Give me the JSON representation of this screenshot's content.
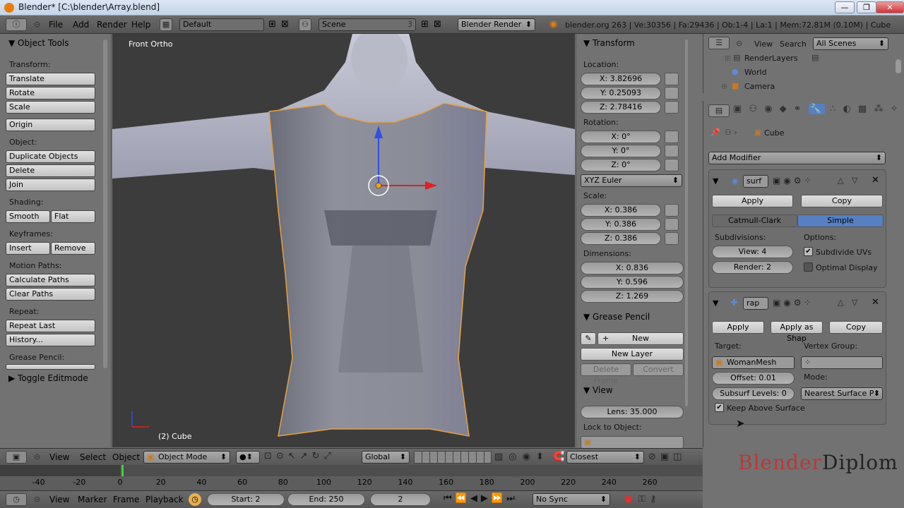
{
  "window": {
    "title": "Blender* [C:\\blender\\Array.blend]",
    "min": "—",
    "max": "❐",
    "close": "✕"
  },
  "info": {
    "menus": [
      "File",
      "Add",
      "Render",
      "Help"
    ],
    "screen": "Default",
    "scene": "Scene",
    "scene_count": "3",
    "engine": "Blender Render",
    "stats": "blender.org 263 | Ve:30356 | Fa:29436 | Ob:1-4 | La:1 | Mem:72.81M (0.10M) | Cube"
  },
  "tools": {
    "header": "Object Tools",
    "transform_label": "Transform:",
    "translate": "Translate",
    "rotate": "Rotate",
    "scale": "Scale",
    "origin": "Origin",
    "object_label": "Object:",
    "duplicate": "Duplicate Objects",
    "delete": "Delete",
    "join": "Join",
    "shading_label": "Shading:",
    "smooth": "Smooth",
    "flat": "Flat",
    "keyframes_label": "Keyframes:",
    "insert": "Insert",
    "remove": "Remove",
    "motion_label": "Motion Paths:",
    "calc_paths": "Calculate Paths",
    "clear_paths": "Clear Paths",
    "repeat_label": "Repeat:",
    "repeat_last": "Repeat Last",
    "history": "History...",
    "grease_label": "Grease Pencil:",
    "toggle_edit": "Toggle Editmode"
  },
  "viewport": {
    "view_name": "Front Ortho",
    "object_label": "(2) Cube"
  },
  "npanel": {
    "transform": "Transform",
    "location_label": "Location:",
    "loc_x": "X: 3.82696",
    "loc_y": "Y: 0.25093",
    "loc_z": "Z: 2.78416",
    "rotation_label": "Rotation:",
    "rot_x": "X: 0°",
    "rot_y": "Y: 0°",
    "rot_z": "Z: 0°",
    "rot_mode": "XYZ Euler",
    "scale_label": "Scale:",
    "sc_x": "X: 0.386",
    "sc_y": "Y: 0.386",
    "sc_z": "Z: 0.386",
    "dim_label": "Dimensions:",
    "dim_x": "X: 0.836",
    "dim_y": "Y: 0.596",
    "dim_z": "Z: 1.269",
    "grease": "Grease Pencil",
    "gp_new": "New",
    "gp_new_layer": "New Layer",
    "gp_delete_frame": "Delete Frame",
    "gp_convert": "Convert",
    "view": "View",
    "lens": "Lens: 35.000",
    "lock_label": "Lock to Object:"
  },
  "outliner": {
    "view": "View",
    "search": "Search",
    "filter": "All Scenes",
    "items": [
      "RenderLayers",
      "World",
      "Camera"
    ]
  },
  "props": {
    "object_name": "Cube",
    "add_modifier": "Add Modifier",
    "mod1": {
      "name": "surf",
      "apply": "Apply",
      "copy": "Copy",
      "tab1": "Catmull-Clark",
      "tab2": "Simple",
      "subdiv_label": "Subdivisions:",
      "options_label": "Options:",
      "view": "View: 4",
      "render": "Render: 2",
      "subdivide_uvs": "Subdivide UVs",
      "optimal": "Optimal Display"
    },
    "mod2": {
      "name": "rap",
      "apply": "Apply",
      "apply_shape": "Apply as Shap",
      "copy": "Copy",
      "target_label": "Target:",
      "vgroup_label": "Vertex Group:",
      "target": "WomanMesh",
      "offset": "Offset: 0.01",
      "subsurf": "Subsurf Levels: 0",
      "mode_label": "Mode:",
      "mode": "Nearest Surface P",
      "keep_above": "Keep Above Surface"
    }
  },
  "vheader": {
    "view": "View",
    "select": "Select",
    "object": "Object",
    "mode": "Object Mode",
    "orientation": "Global",
    "snap": "Closest"
  },
  "timeline": {
    "ticks": [
      "-40",
      "-20",
      "0",
      "20",
      "40",
      "60",
      "80",
      "100",
      "120",
      "140",
      "160",
      "180",
      "200",
      "220",
      "240",
      "260"
    ],
    "current_frame_marker": 2
  },
  "theader": {
    "view": "View",
    "marker": "Marker",
    "frame": "Frame",
    "playback": "Playback",
    "start": "Start: 2",
    "end": "End: 250",
    "current": "2",
    "sync": "No Sync"
  },
  "watermark": {
    "part1": "Blender",
    "part2": "Diplom"
  },
  "colors": {
    "accent": "#5680c2",
    "selection_outline": "#e8a040",
    "viewport_bg": "#3c3c3c"
  }
}
